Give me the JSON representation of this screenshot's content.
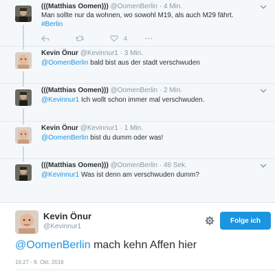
{
  "tweets": [
    {
      "name": "(((Matthias Oomen)))",
      "handle": "@OomenBerlin",
      "time": "4 Min.",
      "text_line1": "Man sollte nur da wohnen, wo sowohl M19, als auch M29 fährt.",
      "text_link": "#Berlin",
      "like_count": "4"
    },
    {
      "name": "Kevin Önur",
      "handle": "@Kevinnur1",
      "time": "3 Min.",
      "mention": "@OomenBerlin",
      "text": " bald bist aus der stadt verschwuden"
    },
    {
      "name": "(((Matthias Oomen)))",
      "handle": "@OomenBerlin",
      "time": "2 Min.",
      "mention": "@Kevinnur1",
      "text": " Ich wollt schon immer mal verschwuden."
    },
    {
      "name": "Kevin Önur",
      "handle": "@Kevinnur1",
      "time": "1 Min.",
      "mention": "@OomenBerlin",
      "text": " bist du dumm oder was!"
    },
    {
      "name": "(((Matthias Oomen)))",
      "handle": "@OomenBerlin",
      "time": "46 Sek.",
      "mention": "@Kevinnur1",
      "text": " Was ist denn am verschwuden dumm?"
    }
  ],
  "main_tweet": {
    "name": "Kevin Önur",
    "handle": "@Kevinnur1",
    "follow_label": "Folge ich",
    "mention": "@OomenBerlin",
    "text": " mach kehn Affen hier",
    "date": "16:27 - 8. Okt. 2016"
  },
  "icons": {
    "reply": "reply-icon",
    "retweet": "retweet-icon",
    "like": "heart-icon",
    "more": "chevron-down-icon",
    "settings": "gear-icon"
  },
  "colors": {
    "link": "#1b95e0",
    "background": "#f5f8fa",
    "button": "#1b95e0"
  }
}
